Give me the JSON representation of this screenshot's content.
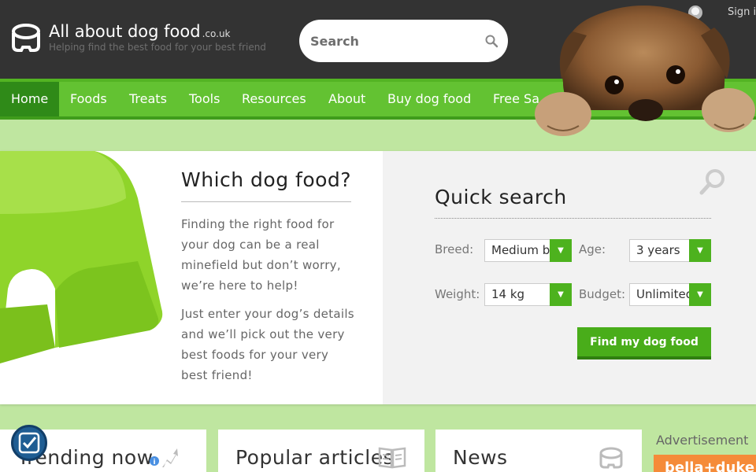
{
  "header": {
    "brand_name": "All about dog food",
    "brand_tld": ".co.uk",
    "tagline": "Helping find the best food for your best friend",
    "search_placeholder": "Search",
    "signin_label": "Sign i"
  },
  "nav": {
    "items": [
      {
        "label": "Home",
        "active": true
      },
      {
        "label": "Foods"
      },
      {
        "label": "Treats"
      },
      {
        "label": "Tools"
      },
      {
        "label": "Resources"
      },
      {
        "label": "About"
      },
      {
        "label": "Buy dog food"
      },
      {
        "label": "Free Sa"
      }
    ]
  },
  "hero": {
    "title": "Which dog food?",
    "paragraph1": "Finding the right food for your dog can be a real minefield but don’t worry, we’re here to help!",
    "paragraph2": "Just enter your dog’s details and we’ll pick out the very best foods for your very best friend!"
  },
  "quick_search": {
    "title": "Quick search",
    "breed_label": "Breed:",
    "breed_value": "Medium b",
    "age_label": "Age:",
    "age_value": "3 years",
    "weight_label": "Weight:",
    "weight_value": "14 kg",
    "budget_label": "Budget:",
    "budget_value": "Unlimited",
    "button_label": "Find my dog food"
  },
  "cards": {
    "trending": "Trending now",
    "popular": "Popular articles",
    "news": "News"
  },
  "advert": {
    "label": "Advertisement",
    "banner_text": "bella+duke"
  },
  "colors": {
    "header_bg": "#333333",
    "nav_green": "#63c232",
    "nav_active": "#2f8a18",
    "page_bg": "#bfe6a0",
    "button_green": "#49ad1a",
    "ad_orange": "#f58b39"
  },
  "icons": [
    "logo-bowl-icon",
    "search-icon",
    "user-icon",
    "magnifier-icon",
    "info-icon",
    "trend-arrow-icon",
    "newspaper-icon",
    "bowl-icon",
    "accessibility-icon"
  ]
}
